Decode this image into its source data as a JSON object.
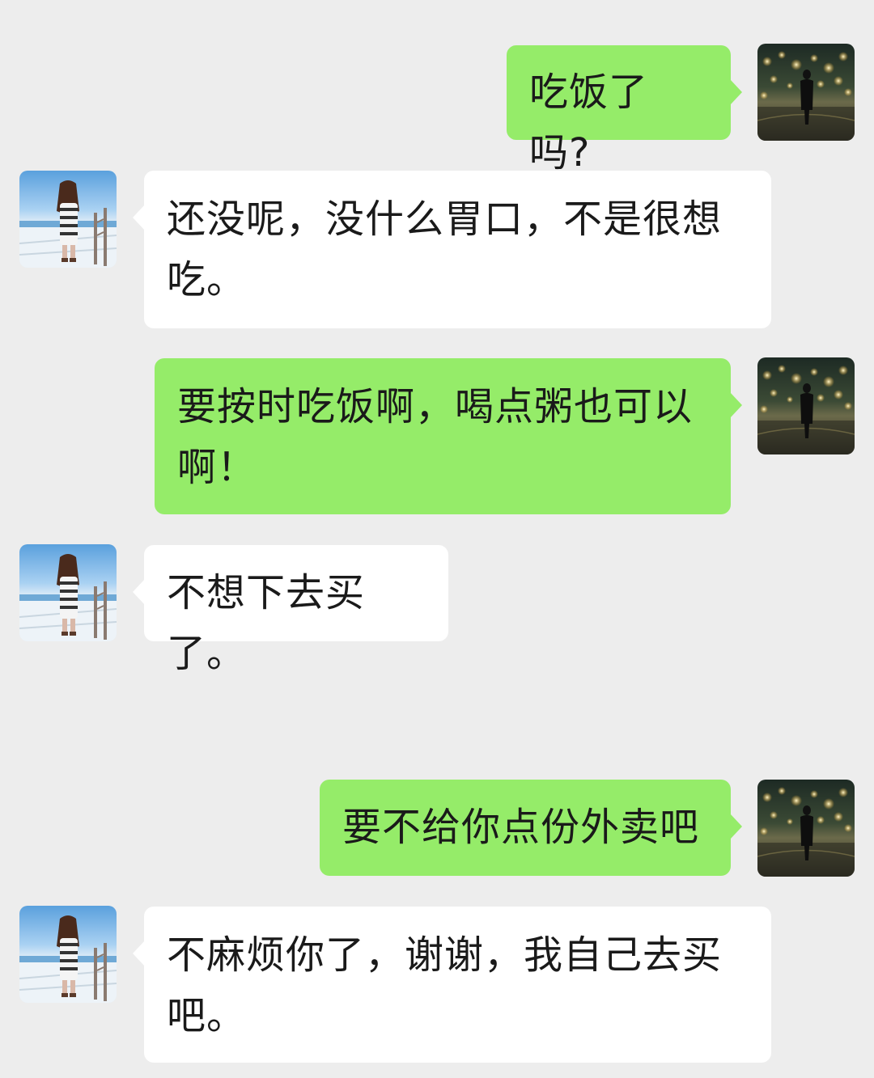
{
  "chat": {
    "messages": [
      {
        "from": "me",
        "avatar": "night-street-avatar",
        "text": "吃饭了吗?"
      },
      {
        "from": "friend",
        "avatar": "snow-girl-avatar",
        "text": "还没呢，没什么胃口，不是很想吃。"
      },
      {
        "from": "me",
        "avatar": "night-street-avatar",
        "text": "要按时吃饭啊，喝点粥也可以啊！"
      },
      {
        "from": "friend",
        "avatar": "snow-girl-avatar",
        "text": "不想下去买了。"
      },
      {
        "from": "me",
        "avatar": "night-street-avatar",
        "text": "要不给你点份外卖吧"
      },
      {
        "from": "friend",
        "avatar": "snow-girl-avatar",
        "text": "不麻烦你了，谢谢，我自己去买吧。"
      }
    ]
  },
  "colors": {
    "background": "#ededed",
    "sent_bubble": "#95ec69",
    "received_bubble": "#ffffff",
    "text": "#1a1a1a"
  }
}
